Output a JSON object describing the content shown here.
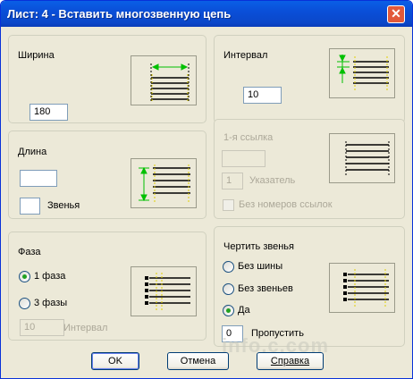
{
  "window": {
    "title": "Лист: 4 - Вставить многозвенную цепь",
    "close_symbol": "✕"
  },
  "width_panel": {
    "label": "Ширина",
    "value": "180"
  },
  "interval_panel": {
    "label": "Интервал",
    "value": "10"
  },
  "length_panel": {
    "label": "Длина",
    "length_value": "",
    "links_value": "",
    "links_label": "Звенья"
  },
  "ref_panel": {
    "label": "1-я ссылка",
    "ref_value": "",
    "pointer_value": "1",
    "pointer_label": "Указатель",
    "no_numbers_label": "Без номеров ссылок"
  },
  "phase_panel": {
    "label": "Фаза",
    "option1": "1 фаза",
    "option3": "3 фазы",
    "interval_value": "10",
    "interval_label": "Интервал",
    "selected": "1 фаза"
  },
  "draw_panel": {
    "label": "Чертить звенья",
    "opt_no_bus": "Без шины",
    "opt_no_links": "Без звеньев",
    "opt_yes": "Да",
    "skip_value": "0",
    "skip_label": "Пропустить",
    "selected": "Да"
  },
  "buttons": {
    "ok": "OK",
    "cancel": "Отмена",
    "help": "Справка"
  },
  "watermark": "info.c.com",
  "colors": {
    "accent": "#0a4fd8",
    "dim_arrow": "#00c000",
    "phase_line": "#e0d000"
  }
}
